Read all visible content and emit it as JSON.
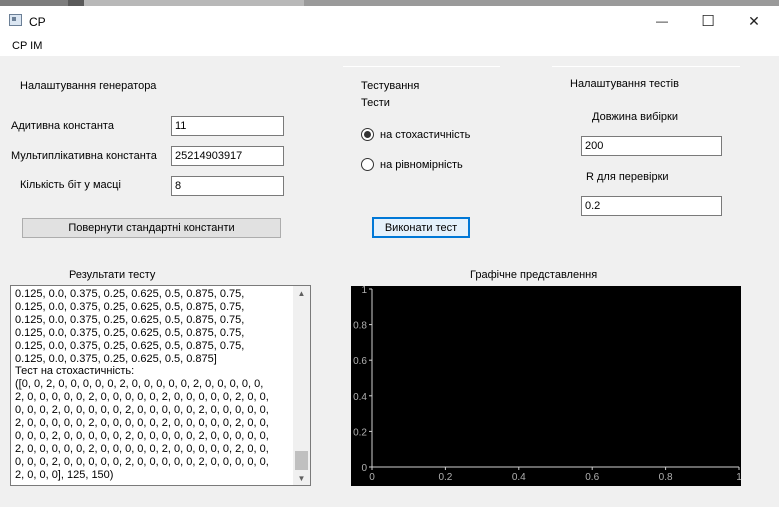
{
  "window": {
    "title": "CP",
    "minimize_glyph": "—",
    "maximize_glyph": "☐",
    "close_glyph": "✕"
  },
  "menu": {
    "items": [
      "CP IM"
    ]
  },
  "generator": {
    "title": "Налаштування генератора",
    "additive_label": "Адитивна константа",
    "additive_value": "11",
    "multiplicative_label": "Мультиплікативна константа",
    "multiplicative_value": "25214903917",
    "bits_label": "Кількість біт у масці",
    "bits_value": "8",
    "reset_button": "Повернути стандартні константи"
  },
  "testing": {
    "title": "Тестування",
    "tests_label": "Тести",
    "options": [
      {
        "label": "на стохастичність",
        "checked": true
      },
      {
        "label": "на рівномірність",
        "checked": false
      }
    ],
    "run_button": "Виконати тест"
  },
  "test_settings": {
    "title": "Налаштування тестів",
    "sample_length_label": "Довжина вибірки",
    "sample_length_value": "200",
    "r_label": "R для перевірки",
    "r_value": "0.2"
  },
  "results": {
    "title": "Результати тесту",
    "lines": [
      "0.125, 0.0, 0.375, 0.25, 0.625, 0.5, 0.875, 0.75,",
      "0.125, 0.0, 0.375, 0.25, 0.625, 0.5, 0.875, 0.75,",
      "0.125, 0.0, 0.375, 0.25, 0.625, 0.5, 0.875, 0.75,",
      "0.125, 0.0, 0.375, 0.25, 0.625, 0.5, 0.875, 0.75,",
      "0.125, 0.0, 0.375, 0.25, 0.625, 0.5, 0.875, 0.75,",
      "0.125, 0.0, 0.375, 0.25, 0.625, 0.5, 0.875]",
      "Тест на стохастичність:",
      "([0, 0, 2, 0, 0, 0, 0, 0, 2, 0, 0, 0, 0, 0, 2, 0, 0, 0, 0, 0,",
      "2, 0, 0, 0, 0, 0, 2, 0, 0, 0, 0, 0, 2, 0, 0, 0, 0, 0, 2, 0, 0,",
      "0, 0, 0, 2, 0, 0, 0, 0, 0, 2, 0, 0, 0, 0, 0, 2, 0, 0, 0, 0, 0,",
      "2, 0, 0, 0, 0, 0, 2, 0, 0, 0, 0, 0, 2, 0, 0, 0, 0, 0, 2, 0, 0,",
      "0, 0, 0, 2, 0, 0, 0, 0, 0, 2, 0, 0, 0, 0, 0, 2, 0, 0, 0, 0, 0,",
      "2, 0, 0, 0, 0, 0, 2, 0, 0, 0, 0, 0, 2, 0, 0, 0, 0, 0, 2, 0, 0,",
      "0, 0, 0, 2, 0, 0, 0, 0, 0, 2, 0, 0, 0, 0, 0, 2, 0, 0, 0, 0, 0,",
      "2, 0, 0, 0], 125, 150)"
    ],
    "scroll_up": "▲",
    "scroll_down": "▼"
  },
  "graph": {
    "title": "Графічне представлення"
  },
  "chart_data": {
    "type": "scatter",
    "background": "#000000",
    "axis_color": "#d0d0d0",
    "xlim": [
      0,
      1
    ],
    "ylim": [
      0,
      1
    ],
    "x_ticks": [
      "0",
      "0.2",
      "0.4",
      "0.6",
      "0.8",
      "1"
    ],
    "y_ticks": [
      "0",
      "0.2",
      "0.4",
      "0.6",
      "0.8",
      "1"
    ],
    "series": []
  }
}
